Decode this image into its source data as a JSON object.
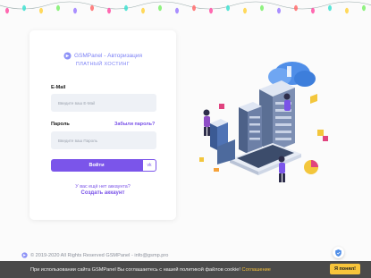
{
  "brand": {
    "title": "GSMPanel - Авторизация",
    "subtitle": "ПЛАТНЫЙ ХОСТИНГ"
  },
  "form": {
    "email_label": "E-Mail",
    "email_placeholder": "Введите ваш E-Mail",
    "password_label": "Пароль",
    "forgot_label": "Забыли пароль?",
    "password_placeholder": "Введите ваш Пароль",
    "login_label": "Войти",
    "vk_label": "vk"
  },
  "signup": {
    "question": "У вас ещё нет аккаунта?",
    "link": "Создать аккаунт"
  },
  "footer": {
    "text": "© 2019-2020 All Rights Reserved GSMPanel - info@gsmp.pro"
  },
  "cookie": {
    "text": "При использовании сайта GSMPanel Вы соглашаетесь с нашей политикой файлов cookie!",
    "link": "Соглашение",
    "accept": "Я понял!"
  },
  "colors": {
    "accent": "#7b55ea",
    "link": "#7a53e8",
    "cookie_bar": "#4a4a4a",
    "cookie_button": "#f8c53b"
  },
  "icons": [
    "gsmpanel-logo-icon",
    "copyright-icon",
    "shield-icon"
  ]
}
